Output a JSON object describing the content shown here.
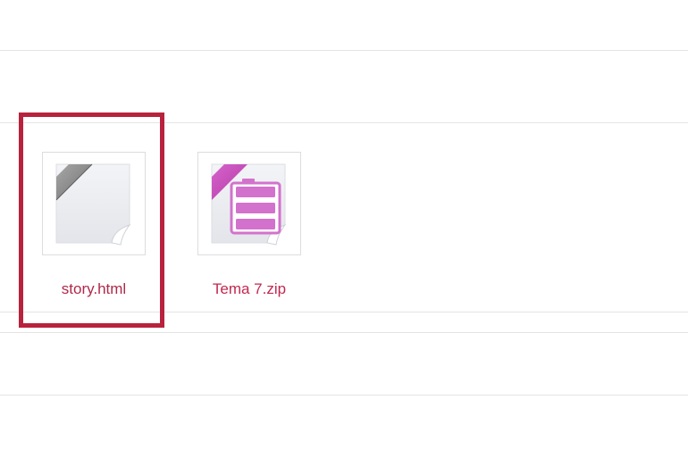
{
  "files": [
    {
      "name": "story.html",
      "icon": "generic-file-icon",
      "selected": true
    },
    {
      "name": "Tema 7.zip",
      "icon": "zip-archive-icon",
      "selected": false
    }
  ],
  "colors": {
    "highlight_border": "#b8223d",
    "filename_text": "#b0294a",
    "zip_ribbon": "#c545b8",
    "zip_body": "#d272cc",
    "generic_ribbon": "#8c8c8c"
  }
}
